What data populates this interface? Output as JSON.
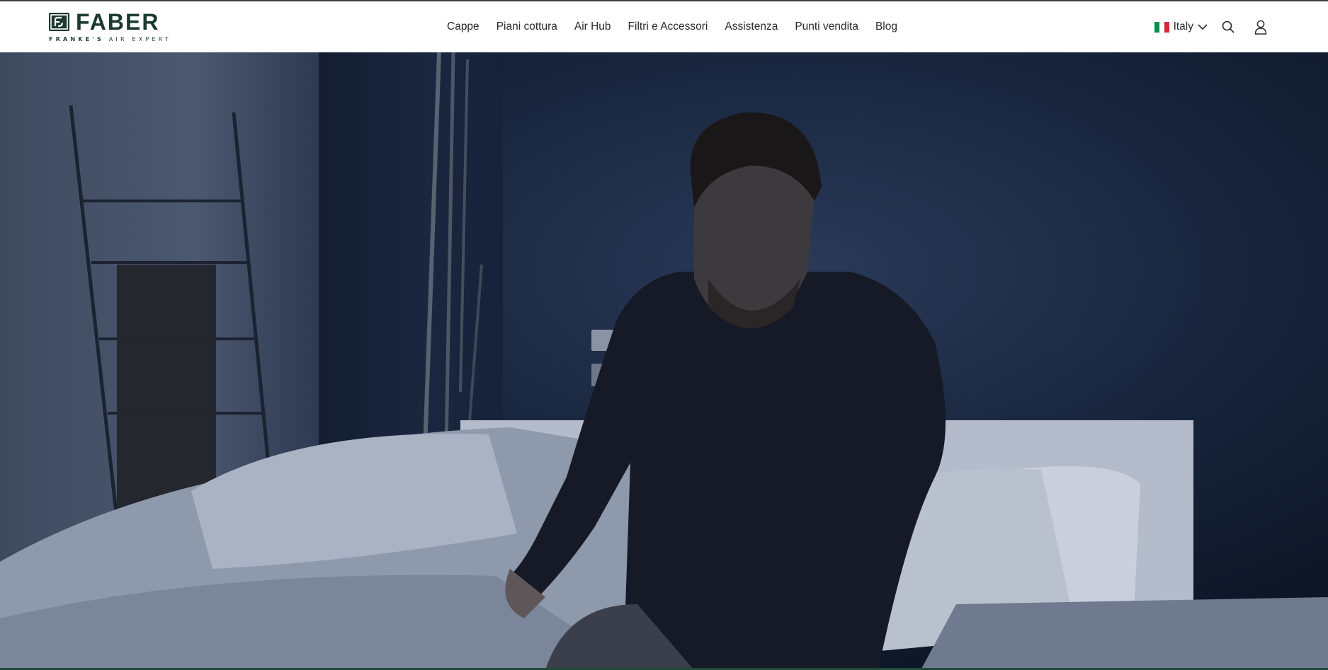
{
  "brand": {
    "name": "FABER",
    "tagline_bold": "FRANKE'S",
    "tagline_light": "AIR EXPERT",
    "primary_color": "#1c3a2e"
  },
  "nav": {
    "items": [
      {
        "label": "Cappe"
      },
      {
        "label": "Piani cottura"
      },
      {
        "label": "Air Hub"
      },
      {
        "label": "Filtri e Accessori"
      },
      {
        "label": "Assistenza"
      },
      {
        "label": "Punti vendita"
      },
      {
        "label": "Blog"
      }
    ]
  },
  "tools": {
    "language": "Italy",
    "flag_colors": [
      "#009246",
      "#ffffff",
      "#ce2b37"
    ],
    "icons": [
      "chevron-down-icon",
      "search-icon",
      "user-icon"
    ]
  },
  "hero": {
    "icon": "hero-image"
  }
}
